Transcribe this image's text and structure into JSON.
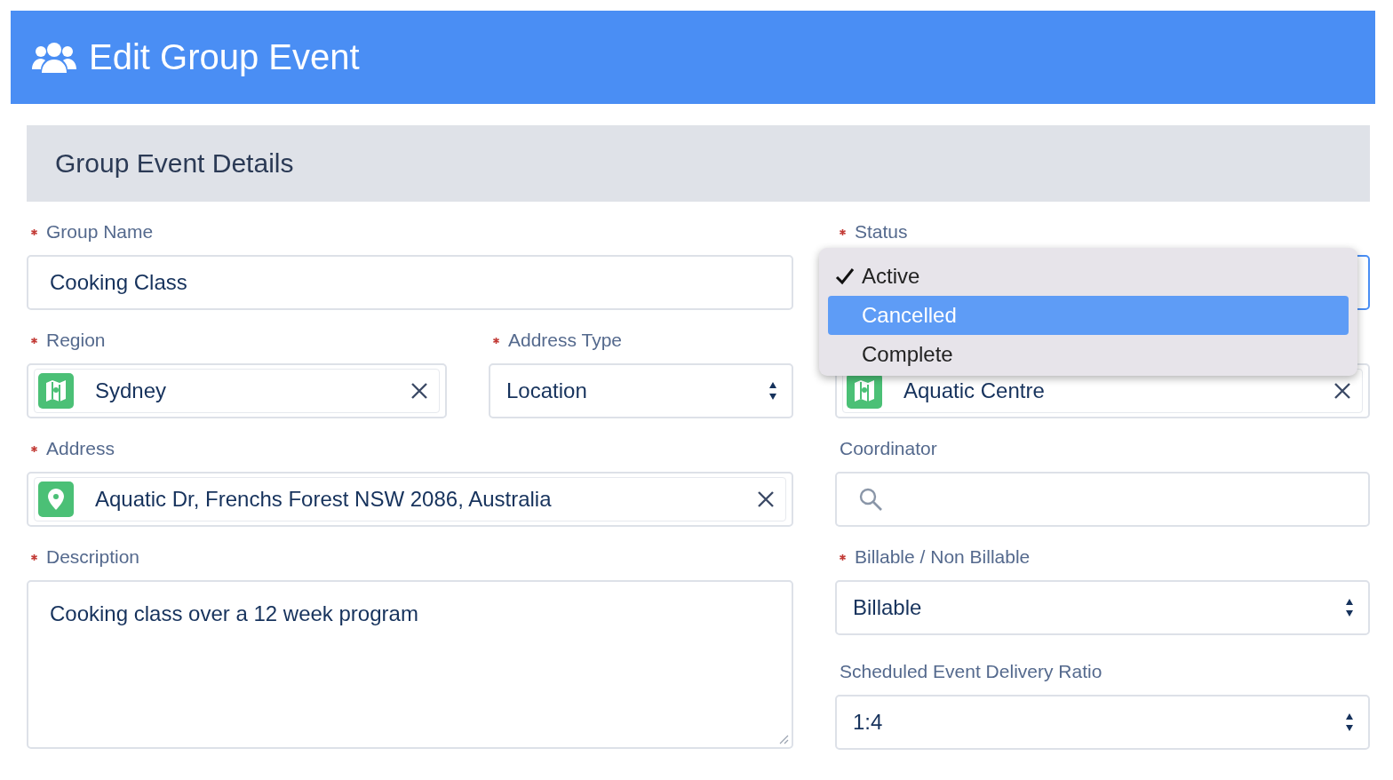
{
  "header": {
    "title": "Edit Group Event"
  },
  "section": {
    "title": "Group Event Details"
  },
  "left": [
    {
      "kind": "text",
      "label": "Group Name",
      "required": true,
      "value": "Cooking Class"
    },
    {
      "kind": "pair",
      "items": [
        {
          "kind": "lookup",
          "label": "Region",
          "required": true,
          "value": "Sydney"
        },
        {
          "kind": "select",
          "label": "Address Type",
          "required": true,
          "value": "Location"
        }
      ]
    },
    {
      "kind": "address",
      "label": "Address",
      "required": true,
      "value": "Aquatic Dr, Frenchs Forest NSW 2086, Australia"
    },
    {
      "kind": "textarea",
      "label": "Description",
      "required": true,
      "value": "Cooking class over a 12 week program"
    }
  ],
  "right": [
    {
      "kind": "select",
      "label": "Status",
      "required": true,
      "focused": true
    },
    {
      "kind": "lookup",
      "value": "Aquatic Centre"
    },
    {
      "kind": "search",
      "label": "Coordinator",
      "required": false
    },
    {
      "kind": "select",
      "label": "Billable / Non Billable",
      "required": true,
      "value": "Billable"
    },
    {
      "kind": "select",
      "label": "Scheduled Event Delivery Ratio",
      "required": false,
      "value": "1:4"
    }
  ],
  "status_menu": {
    "options": [
      {
        "label": "Active",
        "checked": true,
        "selected": false
      },
      {
        "label": "Cancelled",
        "checked": false,
        "selected": true
      },
      {
        "label": "Complete",
        "checked": false,
        "selected": false
      }
    ]
  }
}
